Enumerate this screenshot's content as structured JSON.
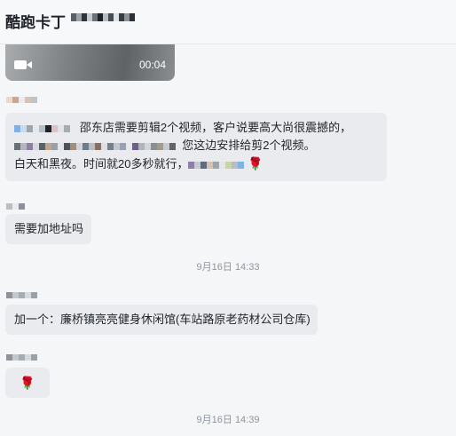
{
  "header": {
    "title": "酷跑卡丁"
  },
  "video": {
    "duration": "00:04",
    "icon": "video-camera-icon"
  },
  "messages": [
    {
      "lines": [
        "邵东店需要剪辑2个视频，客户说要高大尚很震撼的，",
        "您这边安排给剪2个视频。",
        "白天和黑夜。时间就20多秒就行，"
      ],
      "emoji": "🌹"
    },
    {
      "text": "需要加地址吗"
    },
    {
      "text": "加一个：廉桥镇亮亮健身休闲馆(车站路原老药材公司仓库)"
    },
    {
      "emoji": "🌹"
    }
  ],
  "timestamps": [
    "9月16日 14:33",
    "9月16日 14:39"
  ],
  "colors": {
    "bubble": "#e9ebee",
    "background": "#f5f6f8",
    "timestamp": "#8f959e"
  }
}
